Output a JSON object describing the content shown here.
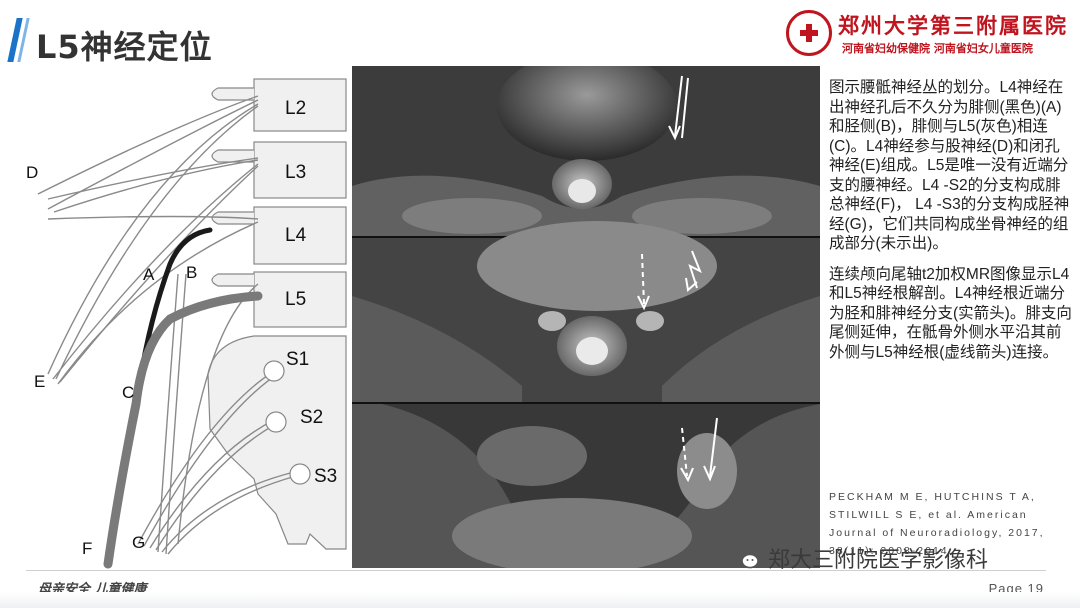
{
  "slide": {
    "title": "L5神经定位",
    "page_label": "Page 19",
    "footer_slogan": "母亲安全 儿童健康"
  },
  "logo": {
    "hospital_name": "郑州大学第三附属医院",
    "subtitle": "河南省妇幼保健院 河南省妇女儿童医院"
  },
  "diagram": {
    "vertebra_labels": [
      "L2",
      "L3",
      "L4",
      "L5"
    ],
    "sacral_labels": [
      "S1",
      "S2",
      "S3"
    ],
    "nerve_labels": [
      "D",
      "A",
      "B",
      "E",
      "C",
      "F",
      "G"
    ],
    "colors": {
      "black_nerve": "#1a1a1a",
      "gray_nerve": "#7a7a7a",
      "bone": "#f0f0f0"
    }
  },
  "description": {
    "paragraph1": "图示腰骶神经丛的划分。L4神经在出神经孔后不久分为腓侧(黑色)(A)和胫侧(B)，腓侧与L5(灰色)相连(C)。L4神经参与股神经(D)和闭孔神经(E)组成。L5是唯一没有近端分支的腰神经。L4 -S2的分支构成腓总神经(F)， L4 -S3的分支构成胫神经(G)，它们共同构成坐骨神经的组成部分(未示出)。",
    "paragraph2": "连续颅向尾轴t2加权MR图像显示L4和L5神经根解剖。L4神经根近端分为胫和腓神经分支(实箭头)。腓支向尾侧延伸，在骶骨外侧水平沿其前外侧与L5神经根(虚线箭头)连接。"
  },
  "reference": "PECKHAM M E, HUTCHINS T A, STILWILL S E, et al. American Journal of Neuroradiology, 2017, 38(11): 2008-2014.",
  "watermark": {
    "icon": "wechat-icon",
    "text": "郑大三附院医学影像科"
  },
  "theme": {
    "accent": "#1a73c8",
    "brand_red": "#c0141e"
  }
}
